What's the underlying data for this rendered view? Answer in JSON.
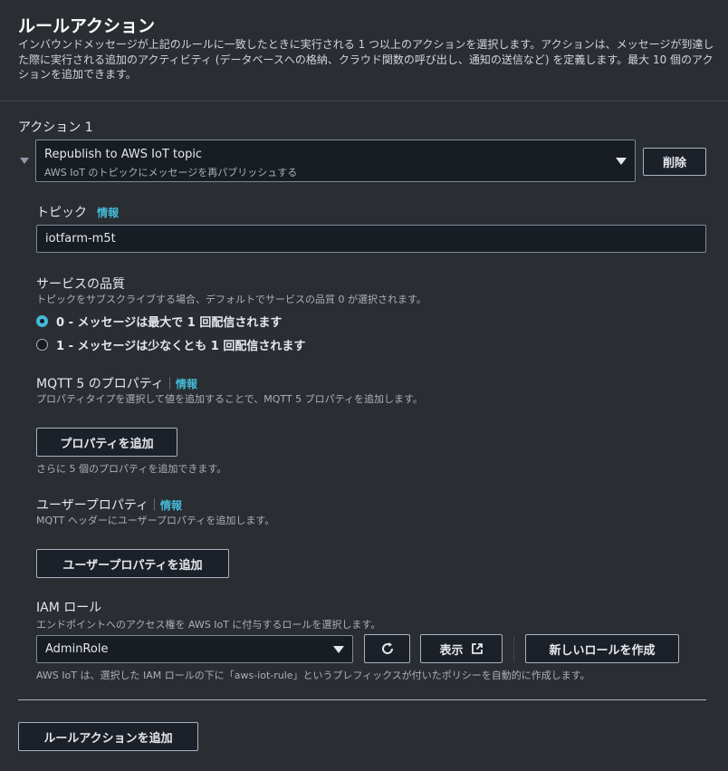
{
  "header": {
    "title": "ルールアクション",
    "description": "インバウンドメッセージが上記のルールに一致したときに実行される 1 つ以上のアクションを選択します。アクションは、メッセージが到達した際に実行される追加のアクティビティ (データベースへの格納、クラウド関数の呼び出し、通知の送信など) を定義します。最大 10 個のアクションを追加できます。"
  },
  "action": {
    "label": "アクション 1",
    "select_title": "Republish to AWS IoT topic",
    "select_sub": "AWS IoT のトピックにメッセージを再パブリッシュする",
    "delete_label": "削除"
  },
  "topic": {
    "label": "トピック",
    "info": "情報",
    "value": "iotfarm-m5t"
  },
  "qos": {
    "label": "サービスの品質",
    "sub": "トピックをサブスクライブする場合、デフォルトでサービスの品質 0 が選択されます。",
    "options": [
      {
        "label": "0 - メッセージは最大で 1 回配信されます",
        "selected": true
      },
      {
        "label": "1 - メッセージは少なくとも 1 回配信されます",
        "selected": false
      }
    ]
  },
  "mqtt5": {
    "label": "MQTT 5 のプロパティ",
    "info": "情報",
    "sub": "プロパティタイプを選択して値を追加することで、MQTT 5 プロパティを追加します。",
    "button": "プロパティを追加",
    "hint": "さらに 5 個のプロパティを追加できます。"
  },
  "user_props": {
    "label": "ユーザープロパティ",
    "info": "情報",
    "sub": "MQTT ヘッダーにユーザープロパティを追加します。",
    "button": "ユーザープロパティを追加"
  },
  "iam": {
    "label": "IAM ロール",
    "sub": "エンドポイントへのアクセス権を AWS IoT に付与するロールを選択します。",
    "value": "AdminRole",
    "view_label": "表示",
    "create_label": "新しいロールを作成",
    "note": "AWS IoT は、選択した IAM ロールの下に「aws-iot-rule」というプレフィックスが付いたポリシーを自動的に作成します。"
  },
  "footer": {
    "add_action": "ルールアクションを追加"
  }
}
